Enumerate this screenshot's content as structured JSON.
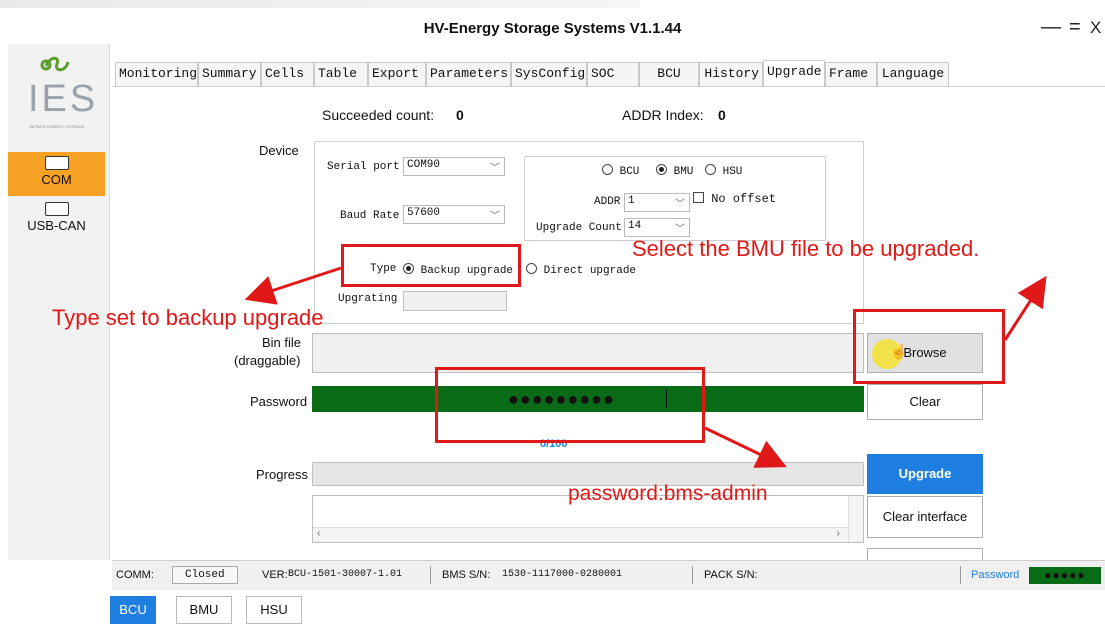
{
  "window": {
    "title": "HV-Energy Storage Systems V1.1.44",
    "controls": {
      "minimize": "—",
      "maximize": "=",
      "close": "X"
    }
  },
  "logo": {
    "text": "IES",
    "tagline": "INFINITE ENERGY STORAGE"
  },
  "sidebar": {
    "items": [
      {
        "label": "COM",
        "icon": "serial-port-icon",
        "active": true
      },
      {
        "label": "USB-CAN",
        "icon": "usb-can-icon",
        "active": false
      }
    ]
  },
  "tabs": [
    "Monitoring",
    "Summary",
    "Cells",
    "Table",
    "Export",
    "Parameters",
    "SysConfig",
    "SOC",
    "BCU",
    "History",
    "Upgrade",
    "Frame",
    "Language"
  ],
  "active_tab": "Upgrade",
  "upgrade": {
    "succeeded_label": "Succeeded count:",
    "succeeded_value": "0",
    "addr_index_label": "ADDR Index:",
    "addr_index_value": "0",
    "device_label": "Device",
    "serial_port_label": "Serial port",
    "serial_port_value": "COM90",
    "baud_rate_label": "Baud Rate",
    "baud_rate_value": "57600",
    "target_options": [
      "BCU",
      "BMU",
      "HSU"
    ],
    "target_selected": "BMU",
    "addr_label": "ADDR",
    "addr_value": "1",
    "no_offset_label": "No offset",
    "upgrade_count_label": "Upgrade Count",
    "upgrade_count_value": "14",
    "type_label": "Type",
    "type_options": [
      "Backup upgrade",
      "Direct upgrade"
    ],
    "type_selected": "Backup upgrade",
    "upgrading_label": "Upgrating",
    "bin_file_label": "Bin file",
    "bin_file_sublabel": "(draggable)",
    "browse_label": "Browse",
    "password_label": "Password",
    "password_value": "●●●●●●●●●",
    "clear_label": "Clear",
    "progress_text": "0/100",
    "progress_label": "Progress",
    "progress_percent": 0,
    "upgrade_button": "Upgrade",
    "clear_interface_button": "Clear interface"
  },
  "annotations": {
    "type_note": "Type set to backup upgrade",
    "browse_note": "Select the BMU file to be upgraded.",
    "password_note": "password:bms-admin"
  },
  "statusbar": {
    "comm_label": "COMM:",
    "comm_value": "Closed",
    "ver_label": "VER:",
    "ver_value": "BCU-1501-30007-1.01",
    "bms_sn_label": "BMS S/N:",
    "bms_sn_value": "1530-1117000-0280001",
    "pack_sn_label": "PACK S/N:",
    "pack_sn_value": "",
    "password_label": "Password",
    "password_value": "●●●●●"
  },
  "bottom_tabs": [
    "BCU",
    "BMU",
    "HSU"
  ],
  "bottom_active": "BCU",
  "colors": {
    "accent_blue": "#1e7fe0",
    "sidebar_active": "#f7a224",
    "password_green": "#0a6b16",
    "annotation_red": "#e11818"
  }
}
